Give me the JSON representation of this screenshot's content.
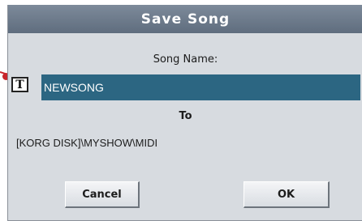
{
  "dialog": {
    "title": "Save Song",
    "song_name_label": "Song Name:",
    "song_name_value": "NEWSONG",
    "text_edit_button": "T",
    "to_label": "To",
    "destination_path": "[KORG DISK]\\MYSHOW\\MIDI",
    "cancel_label": "Cancel",
    "ok_label": "OK"
  },
  "colors": {
    "title_bar": "#6b788a",
    "dialog_background": "#d7dbe0",
    "name_field_background": "#2c6682",
    "pointer_marker": "#c8252a"
  }
}
